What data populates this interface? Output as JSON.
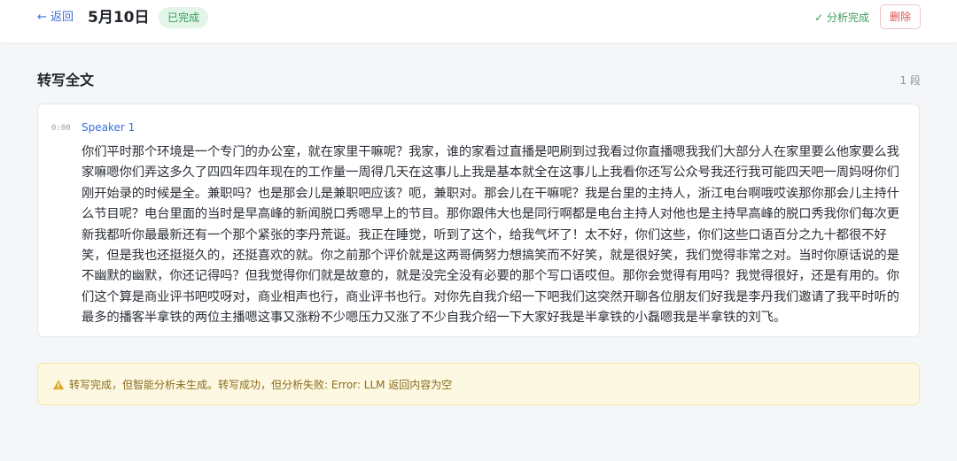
{
  "header": {
    "back_label": "← 返回",
    "title": "5月10日",
    "status_badge": "已完成",
    "analysis_status": "✓ 分析完成",
    "delete_label": "删除"
  },
  "transcript": {
    "section_title": "转写全文",
    "segment_count": "1 段",
    "segments": [
      {
        "time": "0:00",
        "speaker": "Speaker 1",
        "text": "你们平时那个环境是一个专门的办公室，就在家里干嘛呢？我家，谁的家看过直播是吧刷到过我看过你直播嗯我我们大部分人在家里要么他家要么我家嘛嗯你们弄这多久了四四年四年现在的工作量一周得几天在这事儿上我是基本就全在这事儿上我看你还写公众号我还行我可能四天吧一周妈呀你们刚开始录的时候是全。兼职吗？也是那会儿是兼职吧应该？呃，兼职对。那会儿在干嘛呢？我是台里的主持人，浙江电台啊哦哎诶那你那会儿主持什么节目呢？电台里面的当时是早高峰的新闻脱口秀嗯早上的节目。那你跟伟大也是同行啊都是电台主持人对他也是主持早高峰的脱口秀我你们每次更新我都听你最最新还有一个那个紧张的李丹荒诞。我正在睡觉，听到了这个，给我气坏了！太不好，你们这些，你们这些口语百分之九十都很不好笑，但是我也还挺挺久的，还挺喜欢的就。你之前那个评价就是这两哥俩努力想搞笑而不好笑，就是很好笑，我们觉得非常之对。当时你原话说的是不幽默的幽默，你还记得吗？但我觉得你们就是故意的，就是没完全没有必要的那个写口语哎但。那你会觉得有用吗？我觉得很好，还是有用的。你们这个算是商业评书吧哎呀对，商业相声也行，商业评书也行。对你先自我介绍一下吧我们这突然开聊各位朋友们好我是李丹我们邀请了我平时听的最多的播客半拿铁的两位主播嗯这事又涨粉不少嗯压力又涨了不少自我介绍一下大家好我是半拿铁的小磊嗯我是半拿铁的刘飞。"
      }
    ]
  },
  "warning": {
    "icon": "warning-triangle-icon",
    "text": "转写完成，但智能分析未生成。转写成功，但分析失败: Error: LLM 返回内容为空"
  },
  "colors": {
    "accent": "#3b6fd8",
    "success": "#2f9e5a",
    "danger": "#d9534f",
    "warning_bg": "#fdf8e1",
    "warning_text": "#8a6d1f"
  }
}
